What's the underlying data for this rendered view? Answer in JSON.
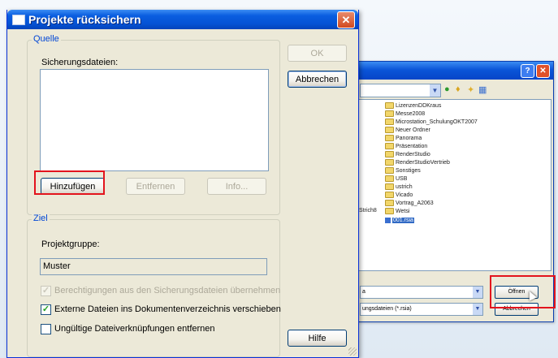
{
  "main_dialog": {
    "title": "Projekte rücksichern",
    "source_group": {
      "label": "Quelle",
      "backup_files_label": "Sicherungsdateien:",
      "add_button": "Hinzufügen",
      "remove_button": "Entfernen",
      "info_button": "Info..."
    },
    "target_group": {
      "label": "Ziel",
      "project_group_label": "Projektgruppe:",
      "project_group_value": "Muster",
      "checkboxes": [
        {
          "label": "Berechtigungen aus den Sicherungsdateien übernehmen",
          "checked": true,
          "enabled": false
        },
        {
          "label": "Externe Dateien ins Dokumentenverzeichnis verschieben",
          "checked": true,
          "enabled": true
        },
        {
          "label": "Ungültige Dateiverknüpfungen entfernen",
          "checked": false,
          "enabled": true
        }
      ]
    },
    "ok_button": "OK",
    "cancel_button": "Abbrechen",
    "help_button": "Hilfe",
    "close_glyph": "✕"
  },
  "background_dialog": {
    "help_glyph": "?",
    "close_glyph": "✕",
    "folders": [
      "LizenzenDDKraus",
      "Messe2008",
      "Microstation_SchulungOKT2007",
      "Neuer Ordner",
      "Panorama",
      "Präsentation",
      "RenderStudio",
      "RenderStudioVertrieb",
      "Sonstiges",
      "USB",
      "ustrich",
      "Vicado",
      "Vortrag_A2063",
      "Wetsi"
    ],
    "selected_file": "001.rsia",
    "left_text": "Strich8",
    "filename_value": "a",
    "filetype_value": "ungsdateien (*.rsia)",
    "open_button": "Öffnen",
    "cancel_button": "Abbrechen"
  },
  "highlight_color": "#e3141d"
}
